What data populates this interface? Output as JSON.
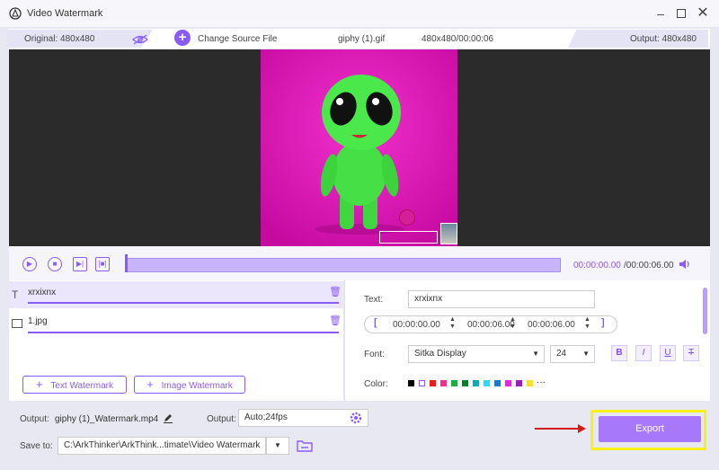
{
  "window": {
    "title": "Video Watermark"
  },
  "infobar": {
    "original": "Original: 480x480",
    "change_source": "Change Source File",
    "filename": "giphy (1).gif",
    "info": "480x480/00:00:06",
    "output": "Output: 480x480"
  },
  "timeline": {
    "current_time": "00:00:00.00",
    "total_time": "/00:00:06.00"
  },
  "watermarks": [
    {
      "type": "text",
      "label": "xrxixnx"
    },
    {
      "type": "image",
      "label": "1.jpg"
    }
  ],
  "buttons": {
    "text_watermark": "Text Watermark",
    "image_watermark": "Image Watermark",
    "export": "Export"
  },
  "editor": {
    "text_label": "Text:",
    "text_value": "xrxixnx",
    "start_time": "00:00:00.00",
    "end_time": "00:00:06.00",
    "duration": "00:00:06.00",
    "font_label": "Font:",
    "font_name": "Sitka Display",
    "font_size": "24",
    "bold": "B",
    "italic": "I",
    "underline": "U",
    "strike": "T",
    "color_label": "Color:",
    "more": "···",
    "colors": [
      "#000000",
      "#ffffff",
      "#e81d1d",
      "#e8358a",
      "#1fae3e",
      "#0d7a2e",
      "#1aa7b2",
      "#3fd3f2",
      "#2078c9",
      "#e02ad8",
      "#9a1fb8",
      "#f5e12e"
    ]
  },
  "bottom": {
    "output_label": "Output:",
    "output_file": "giphy (1)_Watermark.mp4",
    "output_label2": "Output:",
    "output_settings": "Auto;24fps",
    "save_label": "Save to:",
    "save_path": "C:\\ArkThinker\\ArkThink...timate\\Video Watermark"
  }
}
